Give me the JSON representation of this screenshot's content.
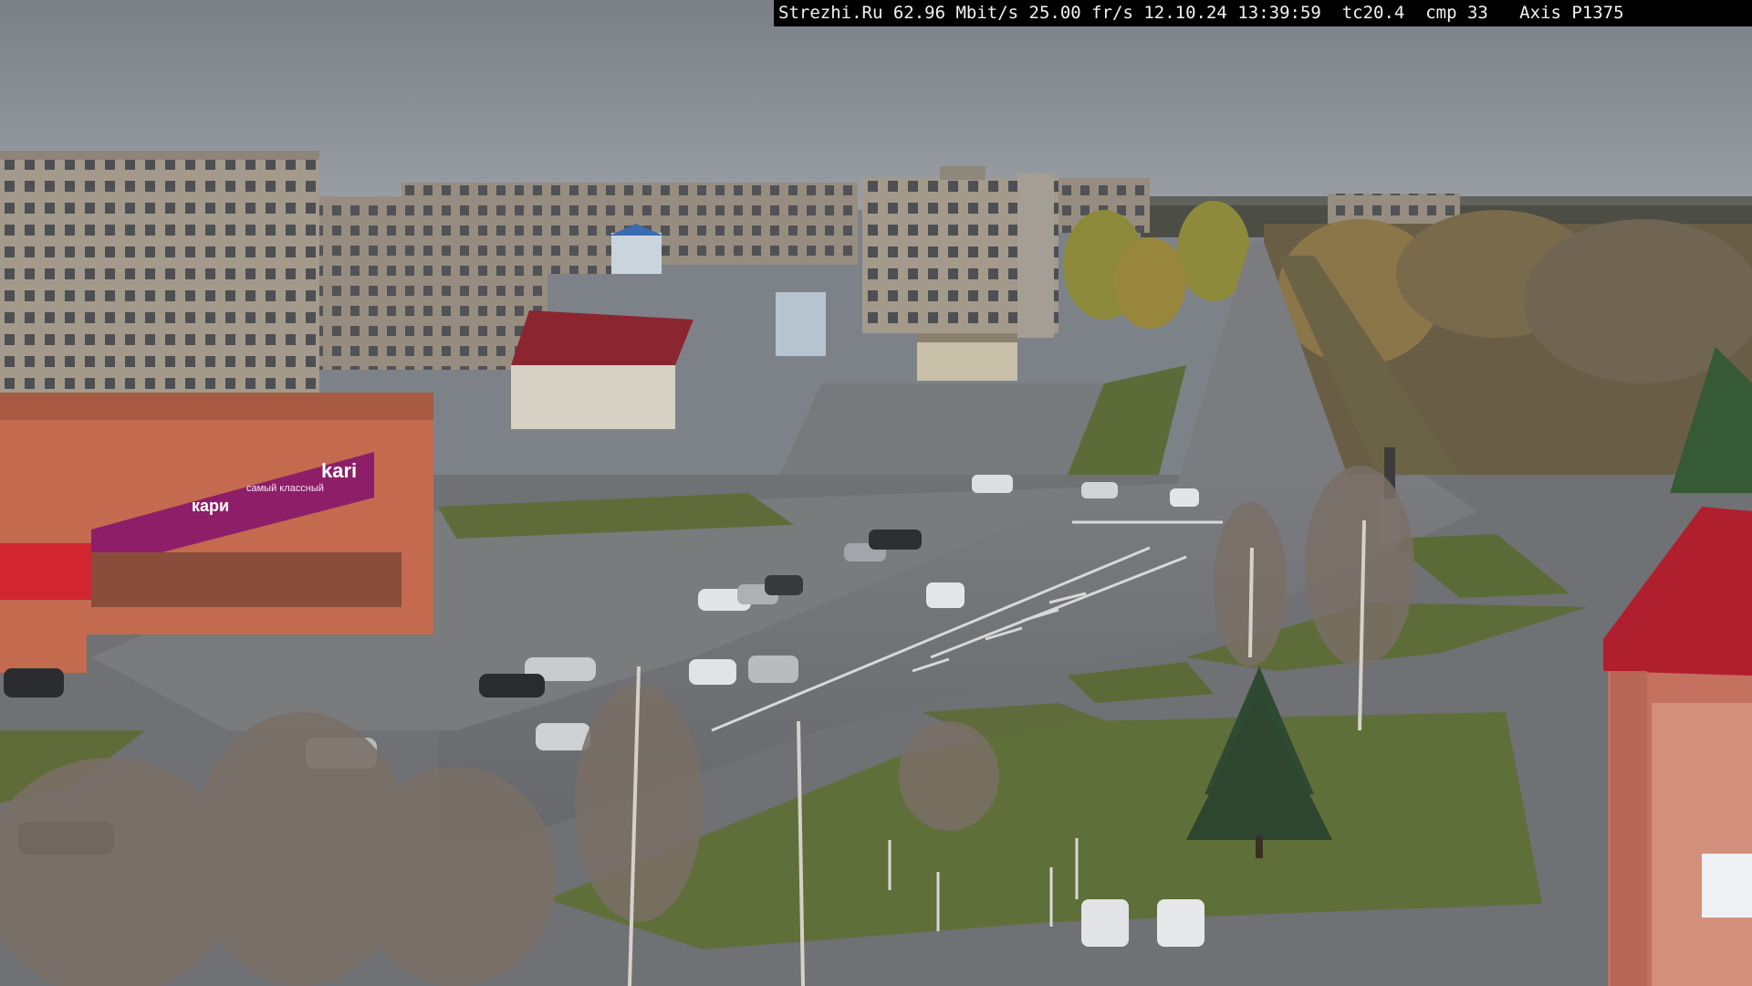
{
  "overlay": {
    "text": "Strezhi.Ru 62.96 Mbit/s 25.00 fr/s 12.10.24 13:39:59  tc20.4  cmp 33   Axis P1375"
  },
  "signs": {
    "store_main": "kari",
    "store_lower": "кари",
    "store_sub": "самый классный"
  },
  "colors": {
    "sky": "#868b92",
    "asphalt": "#6e7073",
    "grass": "#5f6f3a",
    "store_magenta": "#8f1e68",
    "brick": "#c46a4e",
    "roof_red": "#b01f2e"
  }
}
